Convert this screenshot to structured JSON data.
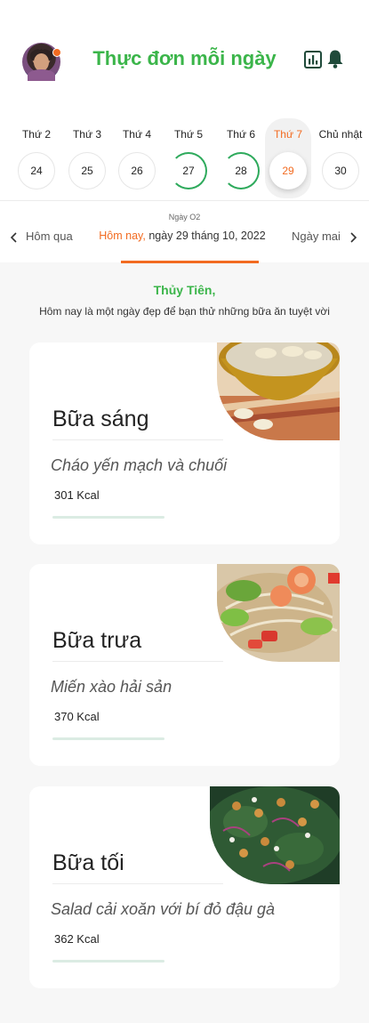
{
  "header": {
    "title": "Thực đơn mỗi ngày",
    "avatar_icon": "user-avatar",
    "notification_dot_color": "#f26b21",
    "chart_icon": "bar-chart-icon",
    "bell_icon": "bell-icon",
    "title_color": "#3bb54a"
  },
  "week": {
    "days": [
      {
        "label": "Thứ 2",
        "date": "24"
      },
      {
        "label": "Thứ 3",
        "date": "25"
      },
      {
        "label": "Thứ 4",
        "date": "26"
      },
      {
        "label": "Thứ 5",
        "date": "27"
      },
      {
        "label": "Thứ 6",
        "date": "28"
      },
      {
        "label": "Thứ 7",
        "date": "29"
      },
      {
        "label": "Chủ nhật",
        "date": "30"
      }
    ],
    "selected_day": "Thứ 7",
    "accent_color": "#f26b21",
    "ring_color": "#2eaa5c"
  },
  "date_nav": {
    "week_label": "Ngày O2",
    "prev": "Hôm qua",
    "today_label": "Hôm nay,",
    "today_date": "ngày 29 tháng 10, 2022",
    "next": "Ngày mai"
  },
  "greeting": {
    "name": "Thủy Tiên,",
    "message": "Hôm nay là một ngày đẹp để bạn thử những bữa ăn tuyệt vời"
  },
  "meals": [
    {
      "title": "Bữa sáng",
      "dish": "Cháo yến mạch và chuối",
      "kcal": "301 Kcal"
    },
    {
      "title": "Bữa trưa",
      "dish": "Miến xào hải sản",
      "kcal": "370 Kcal"
    },
    {
      "title": "Bữa tối",
      "dish": "Salad cải xoăn với bí đỏ đậu gà",
      "kcal": "362 Kcal"
    }
  ]
}
